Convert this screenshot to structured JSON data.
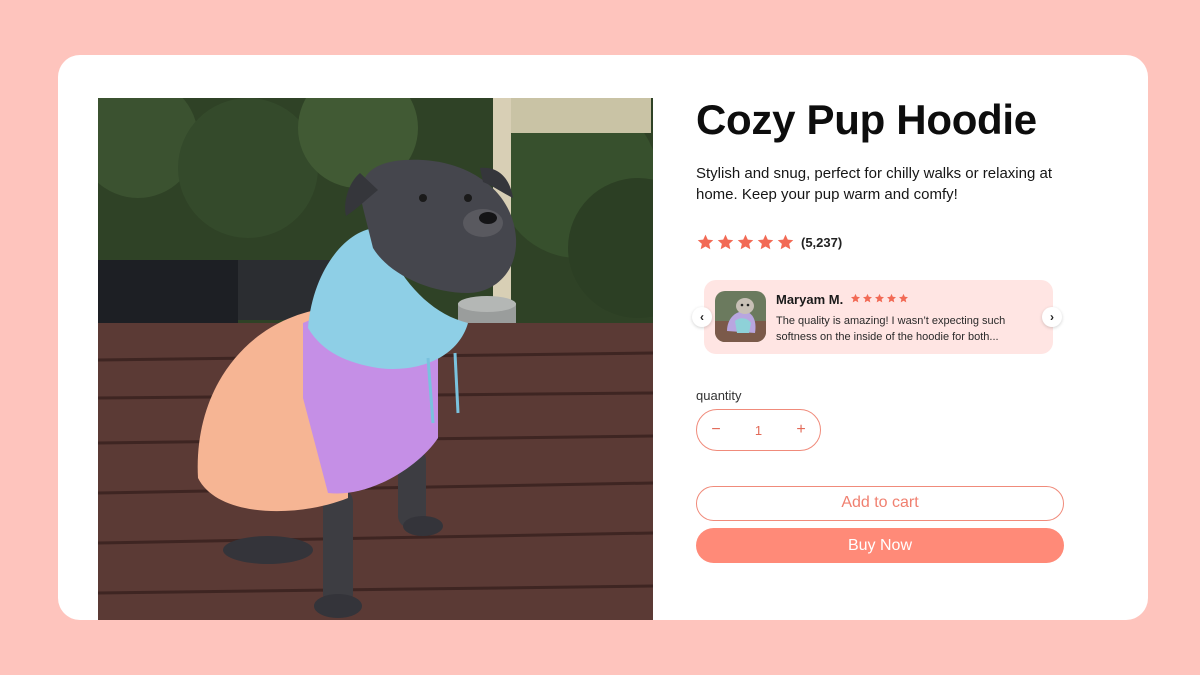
{
  "product": {
    "title": "Cozy Pup Hoodie",
    "description": "Stylish and snug, perfect for chilly walks or relaxing at home. Keep your pup warm and comfy!",
    "rating": 5,
    "rating_count": "(5,237)",
    "image_alt": "dog-wearing-hoodie-photo"
  },
  "review": {
    "author": "Maryam M.",
    "stars": 5,
    "text": "The quality is amazing! I wasn’t expecting such softness on the inside of the hoodie for both...",
    "prev_icon": "chevron-left-icon",
    "next_icon": "chevron-right-icon"
  },
  "quantity": {
    "label": "quantity",
    "value": "1",
    "minus": "−",
    "plus": "+"
  },
  "actions": {
    "add_to_cart": "Add to cart",
    "buy_now": "Buy Now"
  },
  "colors": {
    "page_background": "#fec4bd",
    "accent": "#ff8a78",
    "star": "#f26a55",
    "review_background": "#ffe5e3"
  }
}
